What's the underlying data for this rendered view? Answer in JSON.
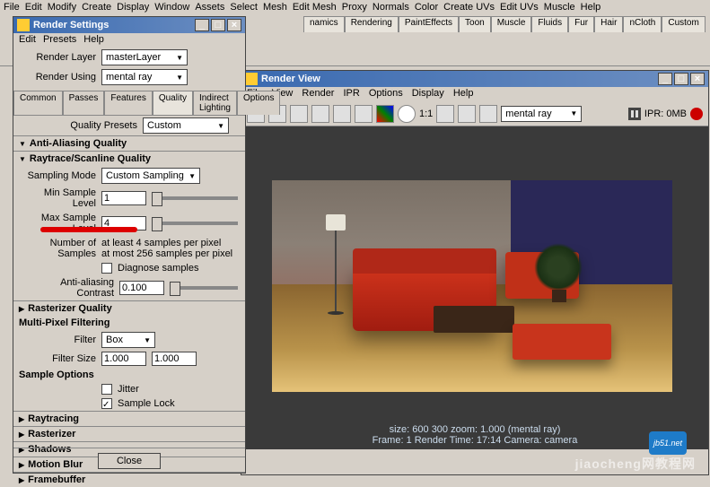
{
  "top_menu": [
    "File",
    "Edit",
    "Modify",
    "Create",
    "Display",
    "Window",
    "Assets",
    "Select",
    "Mesh",
    "Edit Mesh",
    "Proxy",
    "Normals",
    "Color",
    "Create UVs",
    "Edit UVs",
    "Muscle",
    "Help"
  ],
  "shelf_tabs": [
    "namics",
    "Rendering",
    "PaintEffects",
    "Toon",
    "Muscle",
    "Fluids",
    "Fur",
    "Hair",
    "nCloth",
    "Custom"
  ],
  "settings": {
    "title": "Render Settings",
    "menu": [
      "Edit",
      "Presets",
      "Help"
    ],
    "render_layer_label": "Render Layer",
    "render_layer": "masterLayer",
    "render_using_label": "Render Using",
    "render_using": "mental ray",
    "tabs": [
      "Common",
      "Passes",
      "Features",
      "Quality",
      "Indirect Lighting",
      "Options"
    ],
    "active_tab": "Quality",
    "quality_presets_label": "Quality Presets",
    "quality_presets": "Custom",
    "sections": {
      "aa": "Anti-Aliasing Quality",
      "rs": "Raytrace/Scanline Quality",
      "rast": "Rasterizer Quality",
      "mpf": "Multi-Pixel Filtering",
      "so": "Sample Options",
      "rt": "Raytracing",
      "ra": "Rasterizer",
      "sh": "Shadows",
      "mb": "Motion Blur",
      "fb": "Framebuffer"
    },
    "sampling_mode_label": "Sampling Mode",
    "sampling_mode": "Custom Sampling",
    "min_sample_label": "Min Sample Level",
    "min_sample": "1",
    "max_sample_label": "Max Sample Level",
    "max_sample": "4",
    "num_samples_label": "Number of Samples",
    "num_samples_line1": "at least 4 samples per pixel",
    "num_samples_line2": "at most 256 samples per pixel",
    "diagnose_label": "Diagnose samples",
    "aa_contrast_label": "Anti-aliasing Contrast",
    "aa_contrast": "0.100",
    "filter_label": "Filter",
    "filter": "Box",
    "filter_size_label": "Filter Size",
    "filter_size_x": "1.000",
    "filter_size_y": "1.000",
    "jitter_label": "Jitter",
    "sample_lock_label": "Sample Lock",
    "close_btn": "Close"
  },
  "render_view": {
    "title": "Render View",
    "menu": [
      "File",
      "View",
      "Render",
      "IPR",
      "Options",
      "Display",
      "Help"
    ],
    "ratio": "1:1",
    "renderer_select": "mental ray",
    "ipr_label": "IPR: 0MB",
    "status_line1": "size:  600  300 zoom: 1.000          (mental ray)",
    "status_line2": "Frame: 1           Render Time: 17:14         Camera: camera"
  },
  "watermark": "jiaocheng网教程网",
  "js_logo": "jb51.net"
}
